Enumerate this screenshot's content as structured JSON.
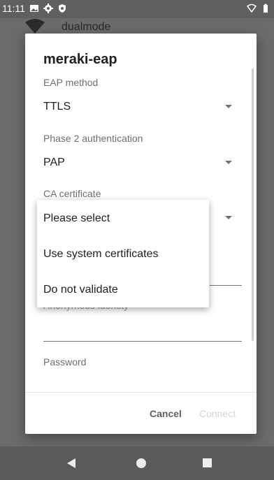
{
  "status_bar": {
    "time": "11:11",
    "icons": [
      "image-icon",
      "gear-icon",
      "shield-icon",
      "wifi-icon",
      "battery-icon"
    ]
  },
  "background_list": {
    "network_name": "dualmode"
  },
  "dialog": {
    "title": "meraki-eap",
    "eap_method": {
      "label": "EAP method",
      "value": "TTLS"
    },
    "phase2": {
      "label": "Phase 2 authentication",
      "value": "PAP"
    },
    "ca_certificate": {
      "label": "CA certificate"
    },
    "anonymous_identity": {
      "label": "Anonymous identity"
    },
    "password": {
      "label": "Password"
    },
    "buttons": {
      "cancel": "Cancel",
      "connect": "Connect"
    }
  },
  "ca_menu": {
    "options": [
      "Please select",
      "Use system certificates",
      "Do not validate"
    ]
  },
  "colors": {
    "scrim": "#6b6b6b",
    "dialog_bg": "#ffffff",
    "text_primary": "#212121",
    "text_secondary": "#6f6f6f",
    "disabled": "#d4d4d4"
  }
}
